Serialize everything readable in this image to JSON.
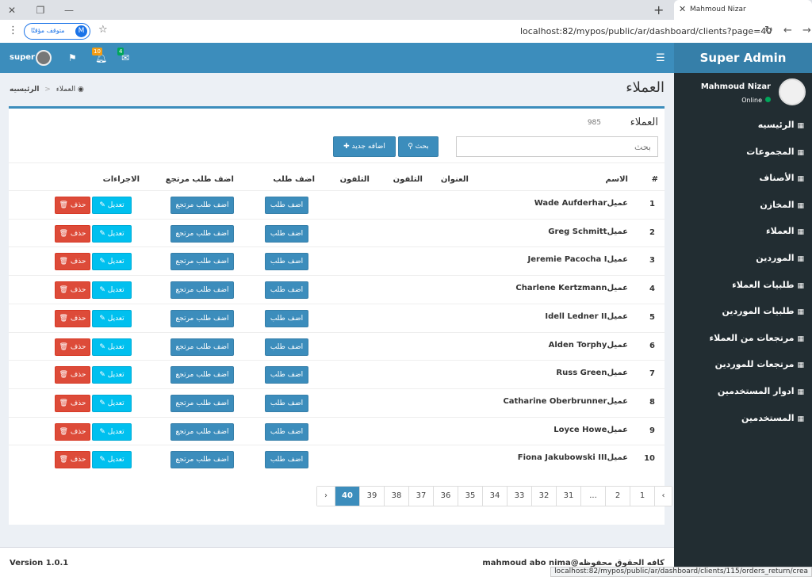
{
  "browser": {
    "tab_title": "Mahmoud Nizar",
    "paused_label": "متوقف مؤقتًا",
    "profile_initial": "M",
    "url": "localhost:82/mypos/public/ar/dashboard/clients?page=40",
    "status_url": "localhost:82/mypos/public/ar/dashboard/clients/115/orders_return/crea"
  },
  "topbar": {
    "user": "super",
    "notif_count": "10",
    "msg_count": "4"
  },
  "sidebar": {
    "logo": "Super Admin",
    "user_name": "Mahmoud Nizar",
    "status": "Online",
    "items": [
      "الرئيسيه",
      "المجموعات",
      "الأصناف",
      "المخازن",
      "العملاء",
      "الموردين",
      "طلبيات العملاء",
      "طلبيات الموردين",
      "مرتجعات من العملاء",
      "مرتجعات للموردين",
      "ادوار المستخدمين",
      "المستخدمين"
    ]
  },
  "page": {
    "title": "العملاء",
    "breadcrumb_home": "الرئيسيه",
    "breadcrumb_sep": "<",
    "breadcrumb_current": "العملاء"
  },
  "box": {
    "title": "العملاء",
    "count": "985",
    "search_placeholder": "بحث",
    "search_button": "بحث",
    "add_button": "اضافه جديد"
  },
  "table": {
    "headers": [
      "#",
      "الاسم",
      "العنوان",
      "التلفون",
      "التلفون",
      "اضف طلب",
      "اضف طلب مرتجع",
      "الاجراءات"
    ],
    "rows": [
      {
        "n": "1",
        "name": "عميلWade Aufderhar"
      },
      {
        "n": "2",
        "name": "عميلGreg Schmitt"
      },
      {
        "n": "3",
        "name": "عميلJeremie Pacocha I"
      },
      {
        "n": "4",
        "name": "عميلCharlene Kertzmann"
      },
      {
        "n": "5",
        "name": "عميلIdell Ledner II"
      },
      {
        "n": "6",
        "name": "عميلAlden Torphy"
      },
      {
        "n": "7",
        "name": "عميلRuss Green"
      },
      {
        "n": "8",
        "name": "عميلCatharine Oberbrunner"
      },
      {
        "n": "9",
        "name": "عميلLoyce Howe"
      },
      {
        "n": "10",
        "name": "عميلFiona Jakubowski III"
      }
    ],
    "order_btn": "اضف طلب",
    "return_btn": "اضف طلب مرتجع",
    "edit_btn": "تعديل",
    "delete_btn": "حذف"
  },
  "pagination": [
    "‹",
    "1",
    "2",
    "...",
    "31",
    "32",
    "33",
    "34",
    "35",
    "36",
    "37",
    "38",
    "39",
    "40",
    "›"
  ],
  "footer": {
    "version": "Version 1.0.1",
    "copyright": "كافه الحقوق محفوظه@mahmoud abo nima"
  }
}
